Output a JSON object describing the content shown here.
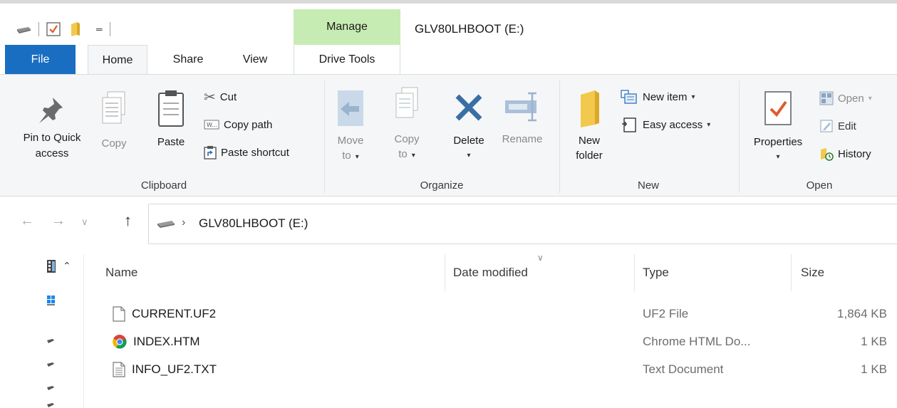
{
  "window": {
    "title": "GLV80LHBOOT (E:)"
  },
  "ribbon_tabs": {
    "file": "File",
    "home": "Home",
    "share": "Share",
    "view": "View",
    "manage_context": "Manage",
    "drive_tools": "Drive Tools"
  },
  "clipboard": {
    "pin": "Pin to Quick access",
    "copy": "Copy",
    "paste": "Paste",
    "cut": "Cut",
    "copy_path": "Copy path",
    "paste_shortcut": "Paste shortcut",
    "label": "Clipboard"
  },
  "organize": {
    "move_to_line1": "Move",
    "move_to_line2": "to",
    "copy_to_line1": "Copy",
    "copy_to_line2": "to",
    "delete": "Delete",
    "rename": "Rename",
    "label": "Organize"
  },
  "new_group": {
    "new_folder_line1": "New",
    "new_folder_line2": "folder",
    "new_item": "New item",
    "easy_access": "Easy access",
    "label": "New"
  },
  "open_group": {
    "properties": "Properties",
    "open": "Open",
    "edit": "Edit",
    "history": "History",
    "label": "Open"
  },
  "address": {
    "path": "GLV80LHBOOT (E:)"
  },
  "columns": {
    "name": "Name",
    "date_modified": "Date modified",
    "type": "Type",
    "size": "Size"
  },
  "files": [
    {
      "name": "CURRENT.UF2",
      "type": "UF2 File",
      "size": "1,864 KB",
      "icon": "blank-file-icon"
    },
    {
      "name": "INDEX.HTM",
      "type": "Chrome HTML Do...",
      "size": "1 KB",
      "icon": "chrome-icon"
    },
    {
      "name": "INFO_UF2.TXT",
      "type": "Text Document",
      "size": "1 KB",
      "icon": "text-file-icon"
    }
  ],
  "colors": {
    "file_tab": "#1a6ec2",
    "manage_context": "#c7ecb3",
    "ribbon_bg": "#f5f6f7",
    "delete_x": "#3a6ea5",
    "folder": "#f2c94c",
    "properties_check": "#e15a2c"
  }
}
